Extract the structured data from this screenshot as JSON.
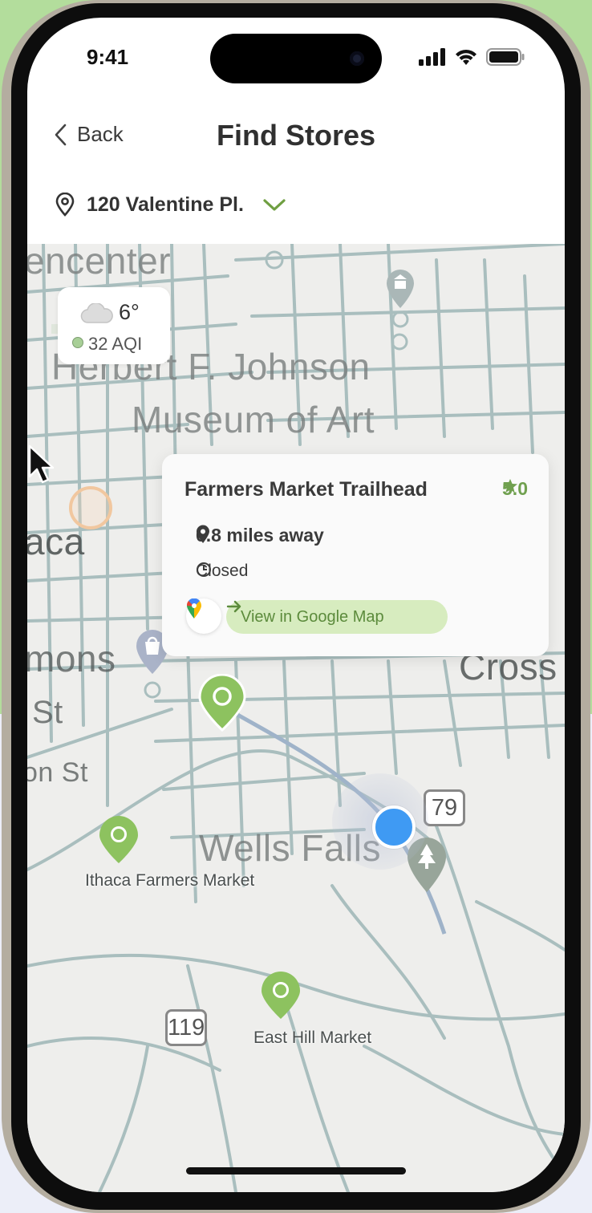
{
  "status_bar": {
    "time": "9:41"
  },
  "nav": {
    "back_label": "Back",
    "title": "Find Stores"
  },
  "location": {
    "address": "120 Valentine Pl."
  },
  "weather": {
    "temperature": "6°",
    "aqi": "32 AQI"
  },
  "store_card": {
    "name": "Farmers Market Trailhead",
    "rating": "5.0",
    "distance": "0.8 miles away",
    "status": "Closed",
    "action_label": "View in Google Map"
  },
  "map_labels": {
    "area_top": "encenter",
    "museum_line1": "Herbert F. Johnson",
    "museum_line2": "Museum of Art",
    "ithaca": "aca",
    "commons": "mons",
    "street1": "St",
    "street2": "on St",
    "cross": "Cross",
    "wells_falls": "Wells Falls",
    "market1": "Ithaca Farmers Market",
    "market2": "East Hill Market",
    "route_79": "79",
    "route_119": "119"
  },
  "icons": {
    "back": "chevron-left-icon",
    "location": "location-pin-icon",
    "dropdown": "chevron-down-icon",
    "weather": "cloud-icon",
    "rating": "star-icon",
    "distance": "map-pin-icon",
    "hours": "clock-icon",
    "maps": "google-maps-icon",
    "action": "arrow-right-icon"
  },
  "colors": {
    "accent": "#8dc25f",
    "my_location": "#3f9af3",
    "map_road": "#a6bcbc"
  }
}
